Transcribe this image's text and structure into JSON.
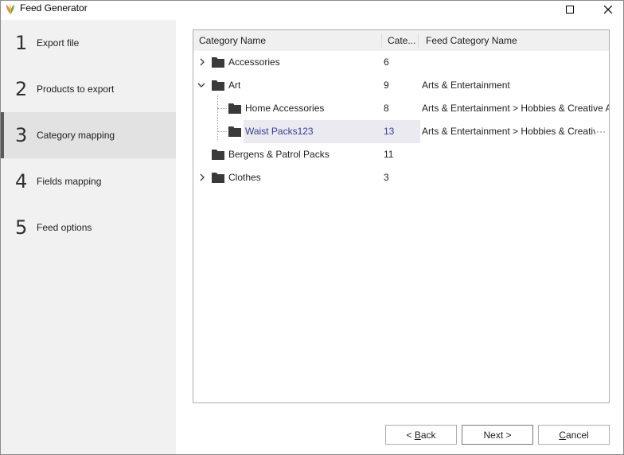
{
  "window": {
    "title": "Feed Generator",
    "icons": {
      "app": "app-logo-icon",
      "maximize": "maximize-icon",
      "close": "close-icon"
    }
  },
  "steps": [
    {
      "num": "1",
      "label": "Export file"
    },
    {
      "num": "2",
      "label": "Products to export"
    },
    {
      "num": "3",
      "label": "Category mapping",
      "active": true
    },
    {
      "num": "4",
      "label": "Fields mapping"
    },
    {
      "num": "5",
      "label": "Feed options"
    }
  ],
  "grid": {
    "columns": [
      "Category Name",
      "Cate...",
      "Feed Category Name"
    ],
    "rows": [
      {
        "name": "Accessories",
        "count": "6",
        "feed": "",
        "expander": "collapsed"
      },
      {
        "name": "Art",
        "count": "9",
        "feed": "Arts & Entertainment",
        "expander": "expanded"
      },
      {
        "name": "Home Accessories",
        "count": "8",
        "feed": "Arts & Entertainment > Hobbies & Creative Ar"
      },
      {
        "name": "Waist Packs123",
        "count": "13",
        "feed": "Arts & Entertainment > Hobbies & Creative",
        "selected": true,
        "overflow_marker": "···"
      },
      {
        "name": "Bergens & Patrol Packs",
        "count": "11",
        "feed": ""
      },
      {
        "name": "Clothes",
        "count": "3",
        "feed": "",
        "expander": "collapsed"
      }
    ]
  },
  "buttons": {
    "back": {
      "prefix": "< ",
      "mnemonic": "B",
      "rest": "ack"
    },
    "next": "Next >",
    "cancel": {
      "mnemonic": "C",
      "rest": "ancel"
    }
  },
  "colors": {
    "sidebar_bg": "#f1f1f1",
    "active_step_bg": "#e2e2e2",
    "active_step_bar": "#5a5a5a",
    "selected_text": "#3b3f8f",
    "folder": "#3a3a3a",
    "app_icon_orange": "#e8892b",
    "app_icon_green": "#6aa84f"
  }
}
